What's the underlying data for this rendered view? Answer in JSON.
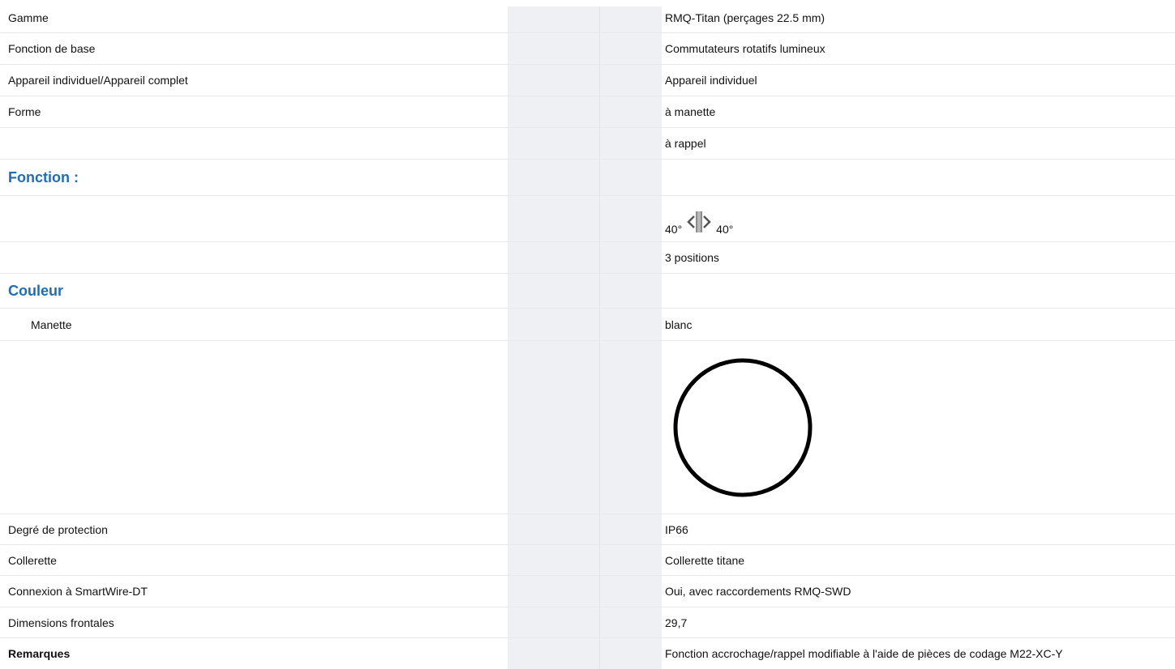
{
  "rows": {
    "gamme": {
      "label": "Gamme",
      "value": "RMQ-Titan (perçages 22.5 mm)"
    },
    "fonction_base": {
      "label": "Fonction de base",
      "value": "Commutateurs rotatifs lumineux"
    },
    "appareil": {
      "label": "Appareil individuel/Appareil complet",
      "value": "Appareil individuel"
    },
    "forme": {
      "label": "Forme",
      "value": "à manette"
    },
    "forme2": {
      "value": "à rappel"
    },
    "fonction_section": {
      "label": "Fonction :"
    },
    "angles": {
      "left": "40°",
      "right": "40°",
      "icon": "rotary-arrows-icon"
    },
    "positions": {
      "value": "3 positions"
    },
    "couleur_section": {
      "label": "Couleur"
    },
    "manette": {
      "label": "Manette",
      "value": "blanc",
      "swatch_color": "#ffffff"
    },
    "protection": {
      "label": "Degré de protection",
      "value": "IP66"
    },
    "collerette": {
      "label": "Collerette",
      "value": "Collerette titane"
    },
    "smartwire": {
      "label": "Connexion à SmartWire-DT",
      "value": "Oui, avec raccordements RMQ-SWD"
    },
    "dimensions": {
      "label": "Dimensions frontales",
      "value": "29,7"
    },
    "remarques": {
      "label": "Remarques",
      "value": "Fonction accrochage/rappel modifiable à l'aide de pièces de codage M22-XC-Y"
    }
  }
}
